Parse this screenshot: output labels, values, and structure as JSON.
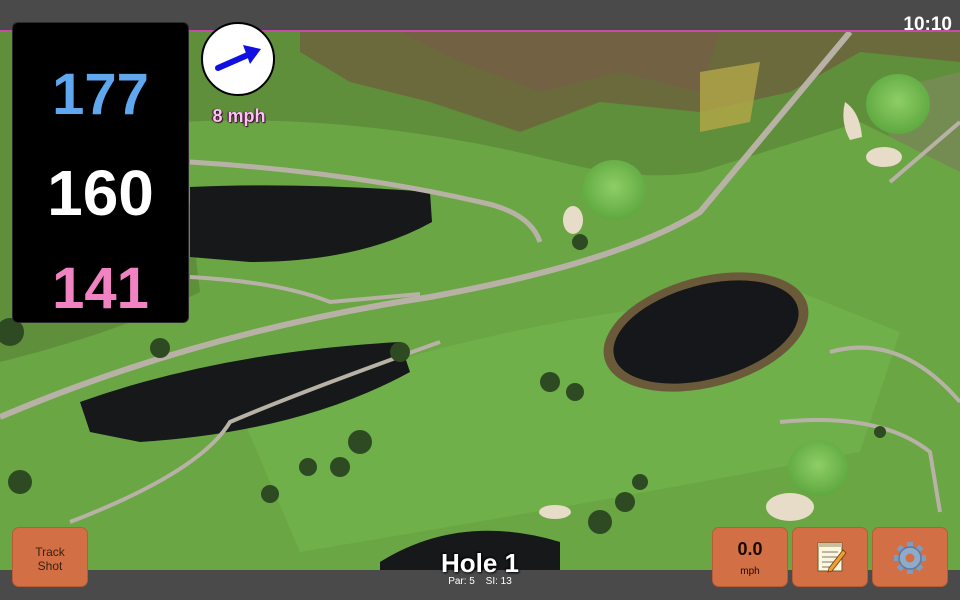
{
  "status_bar": {
    "time": "10:10"
  },
  "distances": {
    "back": "177",
    "middle": "160",
    "front": "141"
  },
  "wind": {
    "speed": "8 mph",
    "direction_icon": "arrow-icon",
    "arrow_color": "#1010e0"
  },
  "buttons": {
    "track_shot_line1": "Track",
    "track_shot_line2": "Shot",
    "speed_value": "0.0",
    "speed_unit": "mph",
    "notes_icon": "notepad-icon",
    "settings_icon": "gear-icon"
  },
  "hole": {
    "title": "Hole 1",
    "par": "Par: 5",
    "si": "SI: 13"
  },
  "colors": {
    "button": "#d26f45",
    "back_distance": "#5fa8f0",
    "front_distance": "#f183c3",
    "accent_border": "#c64aa8"
  }
}
